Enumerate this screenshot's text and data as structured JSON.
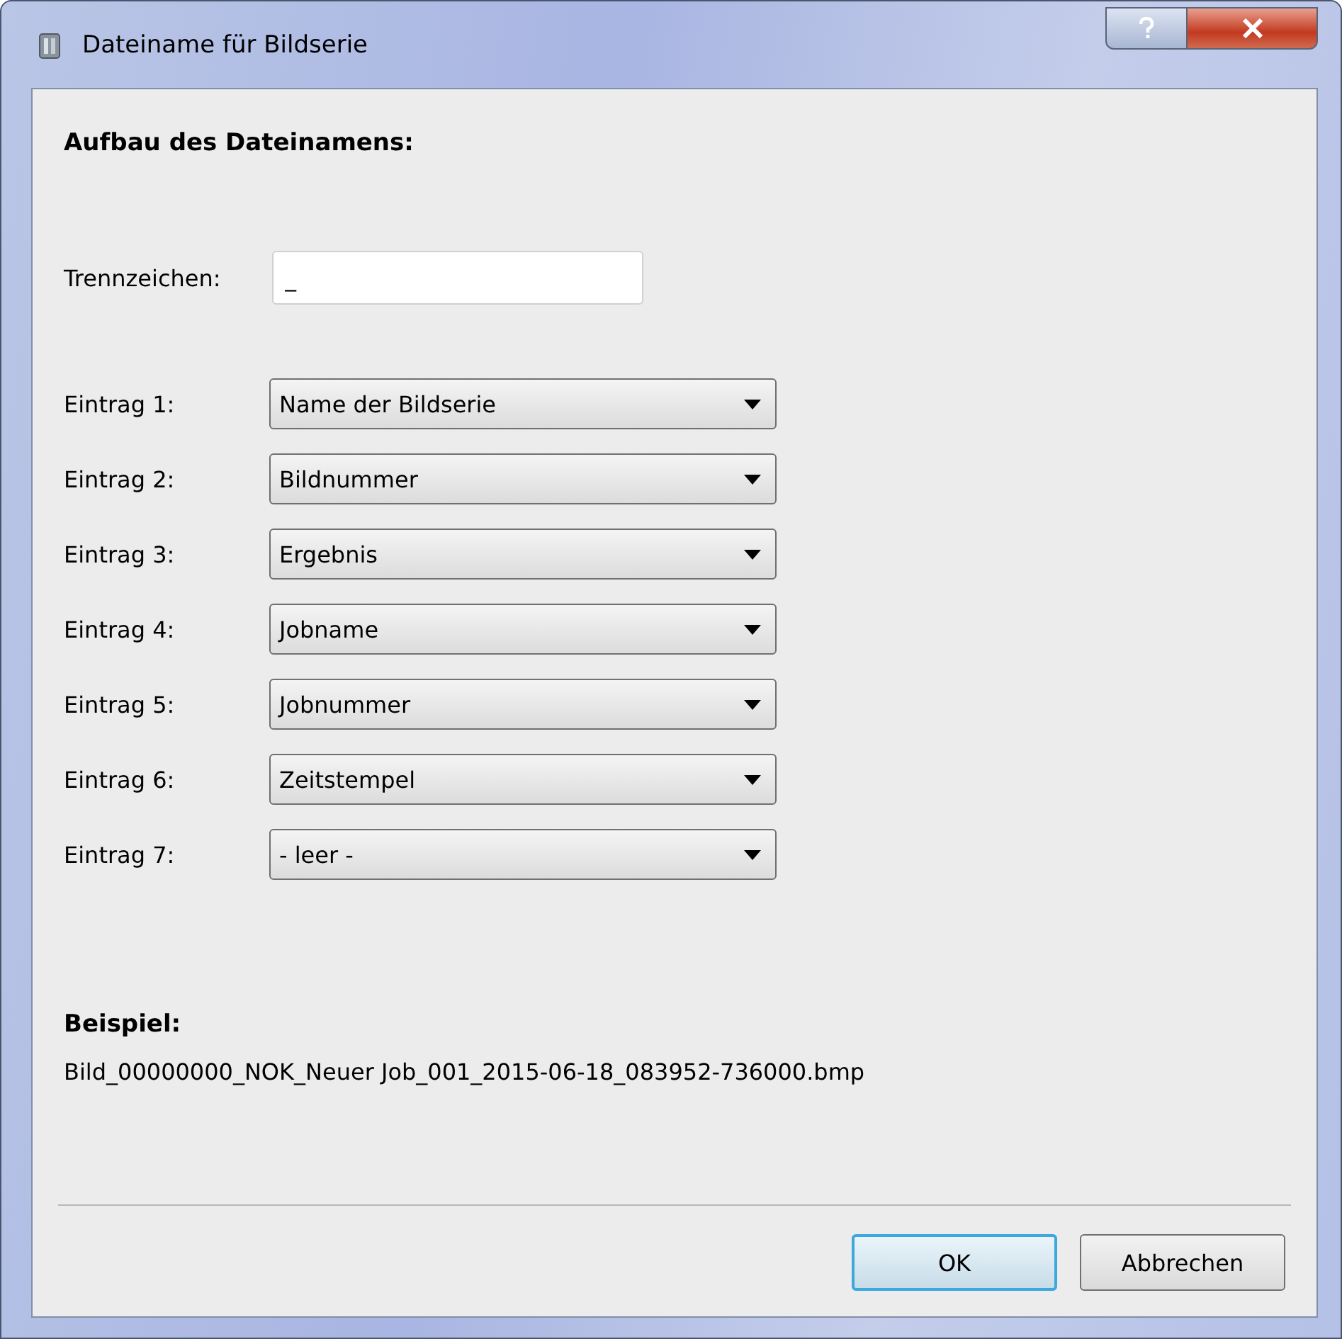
{
  "window": {
    "title": "Dateiname für Bildserie"
  },
  "heading": "Aufbau des Dateinamens:",
  "separator": {
    "label": "Trennzeichen:",
    "value": "_"
  },
  "entries": [
    {
      "label": "Eintrag 1:",
      "value": "Name der Bildserie"
    },
    {
      "label": "Eintrag 2:",
      "value": "Bildnummer"
    },
    {
      "label": "Eintrag 3:",
      "value": "Ergebnis"
    },
    {
      "label": "Eintrag 4:",
      "value": "Jobname"
    },
    {
      "label": "Eintrag 5:",
      "value": "Jobnummer"
    },
    {
      "label": "Eintrag 6:",
      "value": "Zeitstempel"
    },
    {
      "label": "Eintrag 7:",
      "value": "- leer -"
    }
  ],
  "example": {
    "label": "Beispiel:",
    "text": "Bild_00000000_NOK_Neuer Job_001_2015-06-18_083952-736000.bmp"
  },
  "buttons": [
    {
      "label": "OK",
      "default": true
    },
    {
      "label": "Abbrechen",
      "default": false
    }
  ]
}
